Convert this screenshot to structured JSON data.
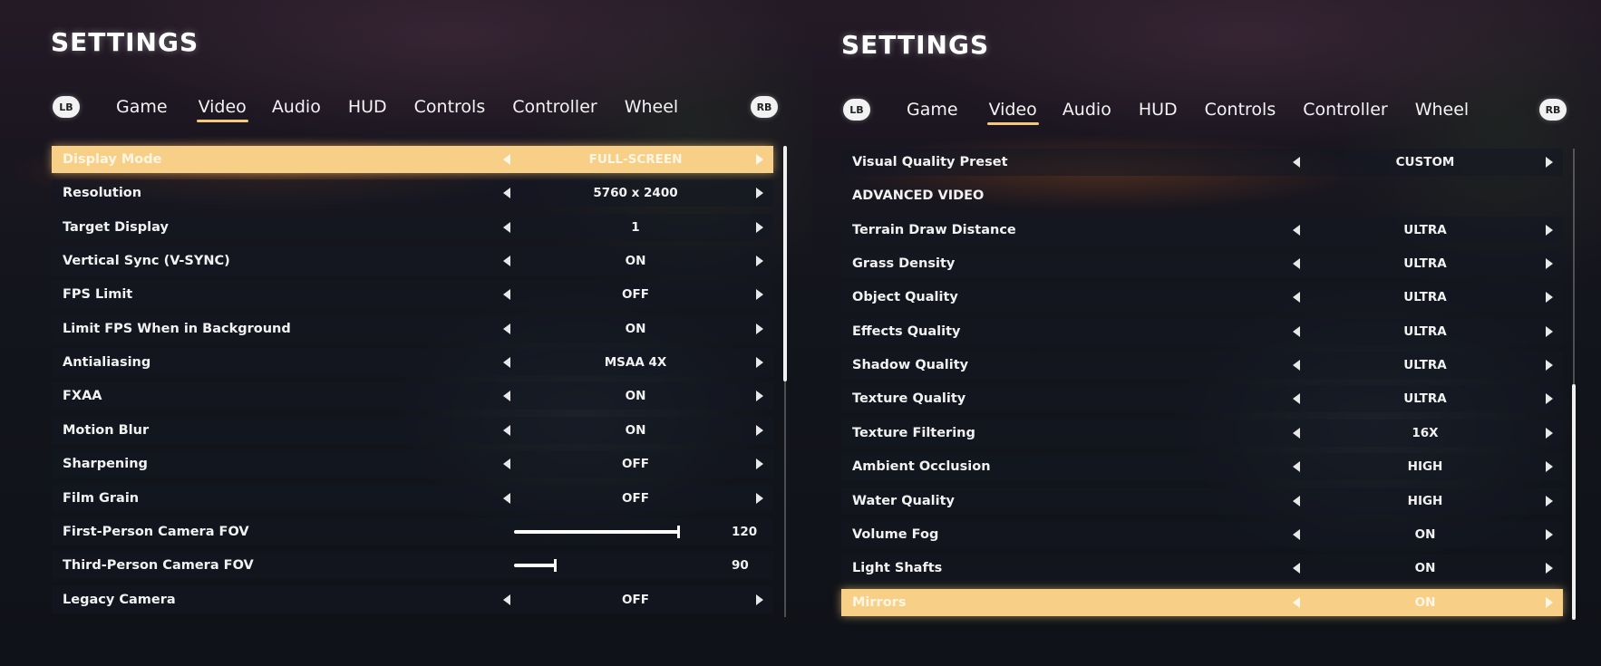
{
  "left": {
    "title": "SETTINGS",
    "lb": "LB",
    "rb": "RB",
    "tabs": [
      "Game",
      "Video",
      "Audio",
      "HUD",
      "Controls",
      "Controller",
      "Wheel"
    ],
    "active_tab": "Video",
    "rows": [
      {
        "label": "Display Mode",
        "value": "FULL-SCREEN"
      },
      {
        "label": "Resolution",
        "value": "5760 x 2400"
      },
      {
        "label": "Target Display",
        "value": "1"
      },
      {
        "label": "Vertical Sync (V-SYNC)",
        "value": "ON"
      },
      {
        "label": "FPS Limit",
        "value": "OFF"
      },
      {
        "label": "Limit FPS When in Background",
        "value": "ON"
      },
      {
        "label": "Antialiasing",
        "value": "MSAA 4X"
      },
      {
        "label": "FXAA",
        "value": "ON"
      },
      {
        "label": "Motion Blur",
        "value": "ON"
      },
      {
        "label": "Sharpening",
        "value": "OFF"
      },
      {
        "label": "Film Grain",
        "value": "OFF"
      },
      {
        "label": "First-Person Camera FOV",
        "value": "120",
        "slider_fraction": 1.0
      },
      {
        "label": "Third-Person Camera FOV",
        "value": "90",
        "slider_fraction": 0.25
      },
      {
        "label": "Legacy Camera",
        "value": "OFF"
      }
    ],
    "highlight_color": "#f8cf86"
  },
  "right": {
    "title": "SETTINGS",
    "lb": "LB",
    "rb": "RB",
    "tabs": [
      "Game",
      "Video",
      "Audio",
      "HUD",
      "Controls",
      "Controller",
      "Wheel"
    ],
    "active_tab": "Video",
    "rows": [
      {
        "label": "Visual Quality Preset",
        "value": "CUSTOM"
      },
      {
        "label": "ADVANCED VIDEO",
        "value": ""
      },
      {
        "label": "Terrain Draw Distance",
        "value": "ULTRA"
      },
      {
        "label": "Grass Density",
        "value": "ULTRA"
      },
      {
        "label": "Object Quality",
        "value": "ULTRA"
      },
      {
        "label": "Effects Quality",
        "value": "ULTRA"
      },
      {
        "label": "Shadow Quality",
        "value": "ULTRA"
      },
      {
        "label": "Texture Quality",
        "value": "ULTRA"
      },
      {
        "label": "Texture Filtering",
        "value": "16X"
      },
      {
        "label": "Ambient Occlusion",
        "value": "HIGH"
      },
      {
        "label": "Water Quality",
        "value": "HIGH"
      },
      {
        "label": "Volume Fog",
        "value": "ON"
      },
      {
        "label": "Light Shafts",
        "value": "ON"
      },
      {
        "label": "Mirrors",
        "value": "ON"
      }
    ]
  }
}
